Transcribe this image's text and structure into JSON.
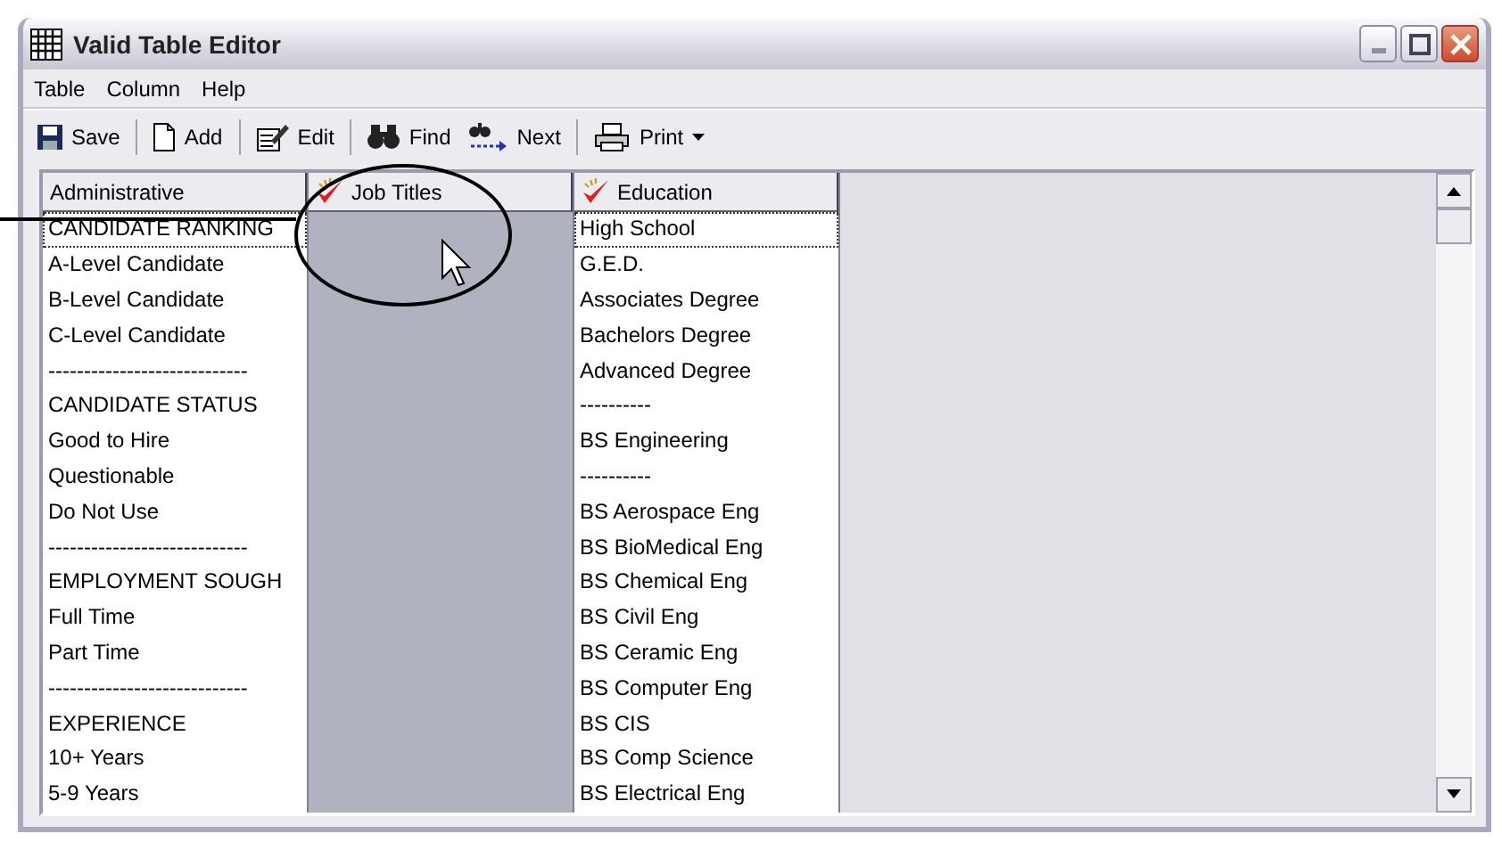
{
  "window": {
    "title": "Valid Table Editor"
  },
  "menu": [
    "Table",
    "Column",
    "Help"
  ],
  "toolbar": [
    {
      "kind": "save",
      "label": "Save",
      "dropdown": false
    },
    {
      "kind": "add",
      "label": "Add",
      "dropdown": false
    },
    {
      "kind": "edit",
      "label": "Edit",
      "dropdown": false
    },
    {
      "kind": "find",
      "label": "Find",
      "dropdown": false
    },
    {
      "kind": "next",
      "label": "Next",
      "dropdown": false
    },
    {
      "kind": "print",
      "label": "Print",
      "dropdown": true
    }
  ],
  "table": {
    "columns": [
      {
        "header": "Administrative",
        "kind": "plain",
        "selected": false,
        "cells": [
          {
            "text": "CANDIDATE RANKING",
            "focused": true
          },
          {
            "text": "A-Level Candidate",
            "focused": false
          },
          {
            "text": "B-Level Candidate",
            "focused": false
          },
          {
            "text": "C-Level Candidate",
            "focused": false
          },
          {
            "text": "----------------------------",
            "focused": false
          },
          {
            "text": "CANDIDATE STATUS",
            "focused": false
          },
          {
            "text": "Good to Hire",
            "focused": false
          },
          {
            "text": "Questionable",
            "focused": false
          },
          {
            "text": "Do Not Use",
            "focused": false
          },
          {
            "text": "----------------------------",
            "focused": false
          },
          {
            "text": "EMPLOYMENT SOUGH",
            "focused": false
          },
          {
            "text": "Full Time",
            "focused": false
          },
          {
            "text": "Part Time",
            "focused": false
          },
          {
            "text": "----------------------------",
            "focused": false
          },
          {
            "text": "EXPERIENCE",
            "focused": false
          },
          {
            "text": "10+ Years",
            "focused": false
          },
          {
            "text": "5-9 Years",
            "focused": false
          }
        ]
      },
      {
        "header": "Job Titles",
        "kind": "validated",
        "selected": true
      },
      {
        "header": "Education",
        "kind": "validated",
        "selected": false,
        "cells": [
          {
            "text": "High School",
            "focused": true
          },
          {
            "text": "G.E.D.",
            "focused": false
          },
          {
            "text": "Associates Degree",
            "focused": false
          },
          {
            "text": "Bachelors Degree",
            "focused": false
          },
          {
            "text": "Advanced Degree",
            "focused": false
          },
          {
            "text": "----------",
            "focused": false
          },
          {
            "text": "BS Engineering",
            "focused": false
          },
          {
            "text": "----------",
            "focused": false
          },
          {
            "text": "BS Aerospace Eng",
            "focused": false
          },
          {
            "text": "BS BioMedical Eng",
            "focused": false
          },
          {
            "text": "BS Chemical Eng",
            "focused": false
          },
          {
            "text": "BS Civil Eng",
            "focused": false
          },
          {
            "text": "BS Ceramic Eng",
            "focused": false
          },
          {
            "text": "BS Computer Eng",
            "focused": false
          },
          {
            "text": "BS CIS",
            "focused": false
          },
          {
            "text": "BS Comp Science",
            "focused": false
          },
          {
            "text": "BS Electrical Eng",
            "focused": false
          }
        ]
      }
    ]
  }
}
